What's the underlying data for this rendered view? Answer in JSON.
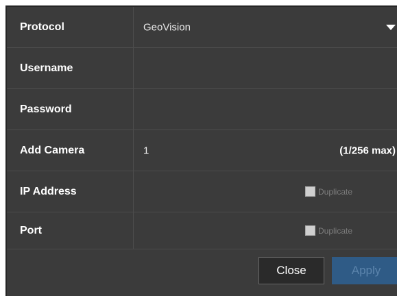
{
  "form": {
    "protocol": {
      "label": "Protocol",
      "value": "GeoVision"
    },
    "username": {
      "label": "Username",
      "value": ""
    },
    "password": {
      "label": "Password",
      "value": ""
    },
    "add_camera": {
      "label": "Add Camera",
      "value": "1",
      "max_text": "(1/256 max)"
    },
    "ip_address": {
      "label": "IP Address",
      "duplicate_label": "Duplicate",
      "duplicate_checked": false
    },
    "port": {
      "label": "Port",
      "duplicate_label": "Duplicate",
      "duplicate_checked": false
    }
  },
  "footer": {
    "close_label": "Close",
    "apply_label": "Apply"
  }
}
